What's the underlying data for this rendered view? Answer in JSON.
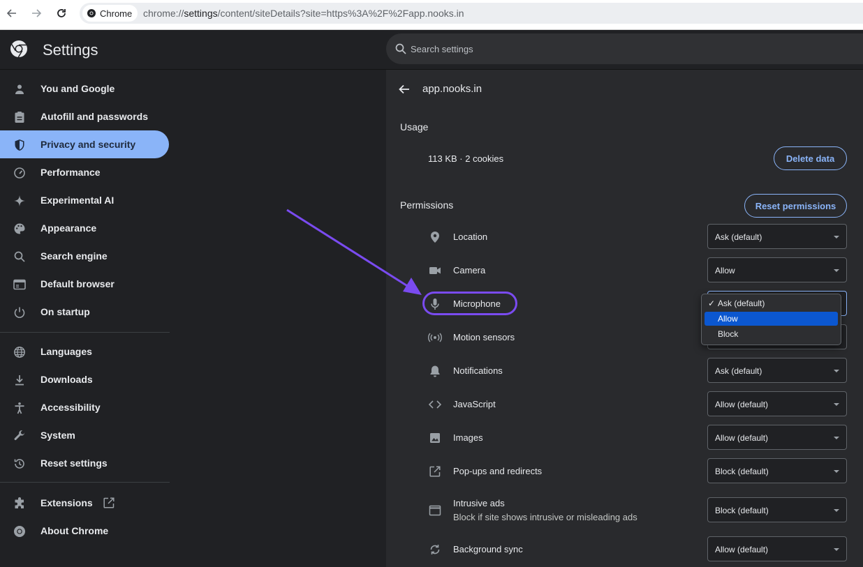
{
  "browser": {
    "chip_label": "Chrome",
    "url_scheme": "chrome://",
    "url_host": "settings",
    "url_path": "/content/siteDetails?site=https%3A%2F%2Fapp.nooks.in"
  },
  "header": {
    "title": "Settings",
    "search_placeholder": "Search settings"
  },
  "sidebar": {
    "items": [
      {
        "label": "You and Google",
        "icon": "person-icon",
        "active": false
      },
      {
        "label": "Autofill and passwords",
        "icon": "clipboard-icon",
        "active": false
      },
      {
        "label": "Privacy and security",
        "icon": "shield-icon",
        "active": true
      },
      {
        "label": "Performance",
        "icon": "speedometer-icon",
        "active": false
      },
      {
        "label": "Experimental AI",
        "icon": "sparkle-icon",
        "active": false
      },
      {
        "label": "Appearance",
        "icon": "palette-icon",
        "active": false
      },
      {
        "label": "Search engine",
        "icon": "search-icon",
        "active": false
      },
      {
        "label": "Default browser",
        "icon": "browser-window-icon",
        "active": false
      },
      {
        "label": "On startup",
        "icon": "power-icon",
        "active": false
      },
      {
        "label": "Languages",
        "icon": "globe-icon",
        "active": false
      },
      {
        "label": "Downloads",
        "icon": "download-icon",
        "active": false
      },
      {
        "label": "Accessibility",
        "icon": "accessibility-icon",
        "active": false
      },
      {
        "label": "System",
        "icon": "wrench-icon",
        "active": false
      },
      {
        "label": "Reset settings",
        "icon": "history-icon",
        "active": false
      },
      {
        "label": "Extensions",
        "icon": "puzzle-icon",
        "active": false
      },
      {
        "label": "About Chrome",
        "icon": "chrome-logo-icon",
        "active": false
      }
    ]
  },
  "main": {
    "site_name": "app.nooks.in",
    "usage_heading": "Usage",
    "usage_text": "113 KB · 2 cookies",
    "delete_button": "Delete data",
    "permissions_heading": "Permissions",
    "reset_button": "Reset permissions",
    "permissions": [
      {
        "label": "Location",
        "icon": "location-pin-icon",
        "value": "Ask (default)"
      },
      {
        "label": "Camera",
        "icon": "camera-icon",
        "value": "Allow"
      },
      {
        "label": "Microphone",
        "icon": "microphone-icon",
        "value": "Allow"
      },
      {
        "label": "Motion sensors",
        "icon": "motion-sensors-icon",
        "value": ""
      },
      {
        "label": "Notifications",
        "icon": "bell-icon",
        "value": "Ask (default)"
      },
      {
        "label": "JavaScript",
        "icon": "code-icon",
        "value": "Allow (default)"
      },
      {
        "label": "Images",
        "icon": "image-icon",
        "value": "Allow (default)"
      },
      {
        "label": "Pop-ups and redirects",
        "icon": "open-external-icon",
        "value": "Block (default)"
      },
      {
        "label": "Intrusive ads",
        "sublabel": "Block if site shows intrusive or misleading ads",
        "icon": "ads-window-icon",
        "value": "Block (default)"
      },
      {
        "label": "Background sync",
        "icon": "sync-icon",
        "value": "Allow (default)"
      }
    ]
  },
  "dropdown": {
    "options": [
      "Ask (default)",
      "Allow",
      "Block"
    ],
    "checked_index": 0,
    "highlighted_index": 1,
    "check_mark": "✓"
  },
  "colors": {
    "accent": "#8ab4f8",
    "annotation": "#7a4bf0",
    "menu_highlight": "#0b57d0"
  }
}
